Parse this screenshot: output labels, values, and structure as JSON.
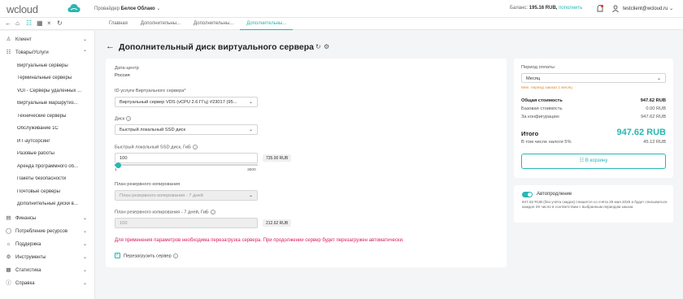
{
  "brand": {
    "name": "wcloud",
    "accent": "#2ab6b0"
  },
  "topbar": {
    "provider_label": "Провайдер",
    "provider_value": "Белое Облако",
    "balance_label": "Баланс:",
    "balance_value": "195.16 RUB,",
    "balance_link": "пополнить",
    "user": "testclient@wcloud.ru"
  },
  "tabs": [
    {
      "label": "Главная"
    },
    {
      "label": "Дополнительны..."
    },
    {
      "label": "Дополнительны..."
    },
    {
      "label": "Дополнительны..."
    }
  ],
  "sidebar": {
    "items": [
      {
        "label": "Клиент",
        "icon": "user-icon"
      },
      {
        "label": "Товары/Услуги",
        "icon": "cart-icon"
      }
    ],
    "sub_items": [
      "Виртуальные серверы",
      "Терминальные серверы",
      "VDI - Серверы удаленных ...",
      "Виртуальные маршрутиз...",
      "Технические серверы",
      "Обслуживание 1С",
      "ИТ-аутсорсинг",
      "Разовые работы",
      "Аренда программного об...",
      "Пакеты безопасности",
      "Почтовые серверы",
      "Дополнительные диски в..."
    ],
    "bottom_items": [
      {
        "label": "Финансы",
        "icon": "finance-icon"
      },
      {
        "label": "Потребление ресурсов",
        "icon": "resources-icon"
      },
      {
        "label": "Поддержка",
        "icon": "support-icon"
      },
      {
        "label": "Инструменты",
        "icon": "tools-icon"
      },
      {
        "label": "Статистика",
        "icon": "stats-icon"
      },
      {
        "label": "Справка",
        "icon": "help-icon"
      }
    ]
  },
  "page": {
    "title": "Дополнительный диск виртуального сервера"
  },
  "form": {
    "datacenter_label": "Дата-центр",
    "datacenter_value": "Россия",
    "service_label": "ID услуги Виртуального сервера",
    "service_value": "Виртуальный сервер VDS (vCPU 2.6 ГГц) #23017 (95...",
    "disk_label": "Диск",
    "disk_value": "Быстрый локальный SSD диск",
    "size_label": "Быстрый локальный SSD диск, ГиБ",
    "size_value": "100",
    "size_price": "735.00 RUB",
    "size_min": "1",
    "size_max": "3600",
    "size_fraction": 0.0275,
    "backup_plan_label": "План резервного копирования",
    "backup_plan_value": "План резервного копирования - 7 дней",
    "backup_size_label": "План резервного копирования - 7 дней, ГиБ",
    "backup_size_value": "100",
    "backup_price": "212.62 RUB",
    "warning": "Для применения параметров необходима перезагрузка сервера. При продолжении сервер будет перезагружен автоматически.",
    "reboot_label": "Перезагрузить сервер",
    "reboot_checked": true
  },
  "summary": {
    "period_label": "Период оплаты",
    "period_value": "Месяц",
    "period_note": "Мин. период заказа 1 месяц",
    "rows": [
      {
        "k": "Общая стоимость",
        "v": "947.62 RUB",
        "bold": true
      },
      {
        "k": "Базовая стоимость",
        "v": "0.00 RUB",
        "bold": false
      },
      {
        "k": "За конфигурацию",
        "v": "947.62 RUB",
        "bold": false
      }
    ],
    "total_label": "Итого",
    "total_value": "947.62 RUB",
    "vat_label": "В том числе налоги 5%",
    "vat_value": "45.12 RUB",
    "cart_button": "В корзину"
  },
  "autorenew": {
    "title": "Автопродление",
    "enabled": true,
    "text": "947.62 RUB (без учёта скидок) спишется со счёта 29 мая 2026 и будет списываться каждое 29 число в соответствии с выбранным периодом заказа"
  }
}
